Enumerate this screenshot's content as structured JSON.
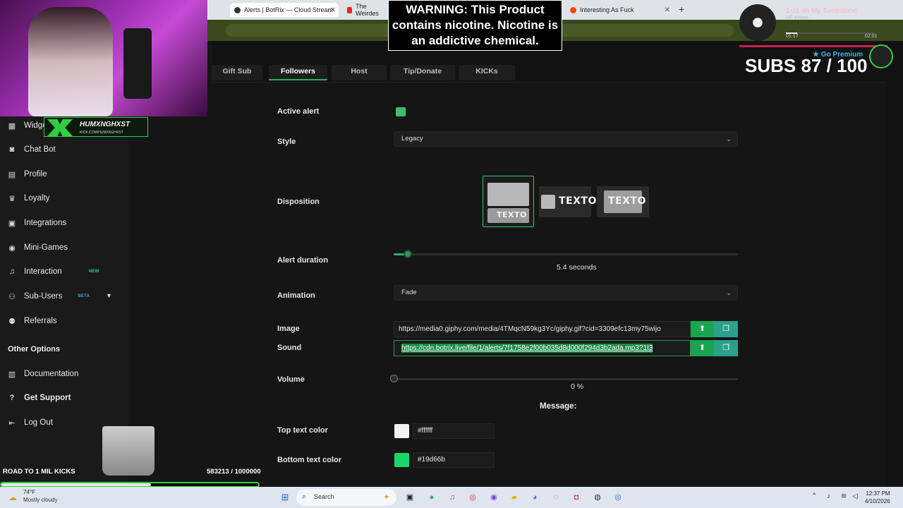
{
  "browser": {
    "tabs": [
      {
        "label": "Alerts | BotRix — Cloud Stream",
        "active": true
      },
      {
        "label": "The Weirdes"
      },
      {
        "label": "Interesting As Fuck"
      }
    ],
    "new_tab": "+",
    "close_glyph": "✕"
  },
  "sidebar": {
    "items": [
      {
        "label": "Widge",
        "icon": "widgets-icon"
      },
      {
        "label": "Chat Bot",
        "icon": "robot-icon"
      },
      {
        "label": "Profile",
        "icon": "profile-icon"
      },
      {
        "label": "Loyalty",
        "icon": "trophy-icon"
      },
      {
        "label": "Integrations",
        "icon": "integrations-icon"
      },
      {
        "label": "Mini-Games",
        "icon": "gamepad-icon"
      },
      {
        "label": "Interaction",
        "icon": "music-icon",
        "badge": "NEW"
      },
      {
        "label": "Sub-Users",
        "icon": "users-icon",
        "badge": "BETA"
      },
      {
        "label": "Referrals",
        "icon": "referrals-icon"
      }
    ],
    "other_heading": "Other Options",
    "other_items": [
      {
        "label": "Documentation",
        "icon": "document-icon"
      },
      {
        "label": "Get Support",
        "icon": "help-icon"
      },
      {
        "label": "Log Out",
        "icon": "logout-icon"
      }
    ]
  },
  "content_tabs": [
    {
      "label": "Gift Sub"
    },
    {
      "label": "Followers",
      "active": true
    },
    {
      "label": "Host"
    },
    {
      "label": "Tip/Donate"
    },
    {
      "label": "KICKs"
    }
  ],
  "form": {
    "active_alert": {
      "label": "Active alert",
      "checked": true
    },
    "style": {
      "label": "Style",
      "value": "Legacy"
    },
    "disposition": {
      "label": "Disposition",
      "option_text": "TEXTO",
      "selected_index": 0
    },
    "alert_duration": {
      "label": "Alert duration",
      "value": "5.4",
      "unit": "seconds",
      "fraction": 0.04
    },
    "animation": {
      "label": "Animation",
      "value": "Fade"
    },
    "image": {
      "label": "Image",
      "value": "https://media0.giphy.com/media/4TMqcN59kg3Yc/giphy.gif?cid=3309efc13my75wijo"
    },
    "sound": {
      "label": "Sound",
      "value": "https://cdn.botrix.live/file/1/alerts/7f1758e2f00b035d8d000f294d3b2ada.mp3?1t3"
    },
    "volume": {
      "label": "Volume",
      "value": "0",
      "unit": "%",
      "fraction": 0
    },
    "message_heading": "Message:",
    "top_text_color": {
      "label": "Top text color",
      "value": "#ffffff"
    },
    "bottom_text_color": {
      "label": "Bottom text color",
      "value": "#19d66b"
    }
  },
  "overlay": {
    "warning": "WARNING: This Product contains nicotine. Nicotine is an addictive chemical.",
    "now_playing": {
      "title": "1-11 on My Tombstone",
      "artist": "MF Khaos",
      "elapsed": "01:17",
      "total": "02:01",
      "progress": 0.13
    },
    "subs": "SUBS 87 / 100",
    "premium": "Go Premium",
    "nametag": "HUMXNGHXST",
    "nametag_sub": "KICK.COM/HUMXNGHXST",
    "road_label": "ROAD TO 1 MIL KICKS",
    "road_count": "583213 / 1000000",
    "road_progress": 0.583
  },
  "taskbar": {
    "temp": "74°F",
    "weather": "Mostly cloudy",
    "search": "Search",
    "time": "12:37 PM",
    "date": "4/10/2026"
  },
  "colors": {
    "accent": "#24b35c",
    "checkbox": "#3cbf6a",
    "top_swatch": "#ffffff",
    "bottom_swatch": "#19d66b"
  }
}
